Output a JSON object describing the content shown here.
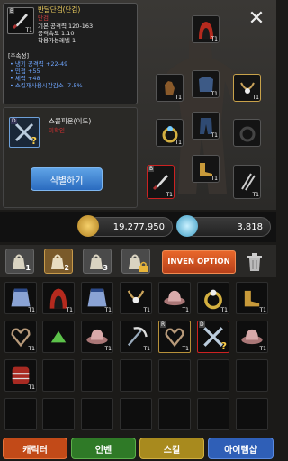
{
  "detail": {
    "item_name": "반달단검(단검)",
    "item_class": "단검",
    "stats": [
      "기본 공격력 120-163",
      "공격속도 1.10",
      "착용가능레벨 1"
    ],
    "option_header": "[주속성]",
    "options": [
      "• 냉기 공격력 +22-49",
      "• 민첩 +55",
      "• 체력 +48",
      "• 스킬재사용시간감소 -7.5%"
    ],
    "grade": "B",
    "tier": "T1"
  },
  "skill": {
    "name": "스콜피온(이도)",
    "sub": "미확인",
    "grade": "D",
    "unknown_mark": "?",
    "identify_label": "식별하기"
  },
  "close_label": "✕",
  "equipment_tier": "T1",
  "currency": {
    "gold": "19,277,950",
    "gem": "3,818",
    "colors": {
      "gold": "#d9a83a",
      "gem": "#5ec6e8"
    }
  },
  "bags": [
    {
      "num": "1",
      "active": false
    },
    {
      "num": "2",
      "active": true
    },
    {
      "num": "3",
      "active": false
    },
    {
      "num": "",
      "active": false
    }
  ],
  "inven_option_label": "INVEN OPTION",
  "grid_tier": "T1",
  "bottom_tabs": [
    {
      "label": "캐릭터",
      "color": "#c24a18"
    },
    {
      "label": "인벤",
      "color": "#2f7a27"
    },
    {
      "label": "스킬",
      "color": "#a88a1e"
    },
    {
      "label": "아이템샵",
      "color": "#2f5fb7"
    }
  ]
}
